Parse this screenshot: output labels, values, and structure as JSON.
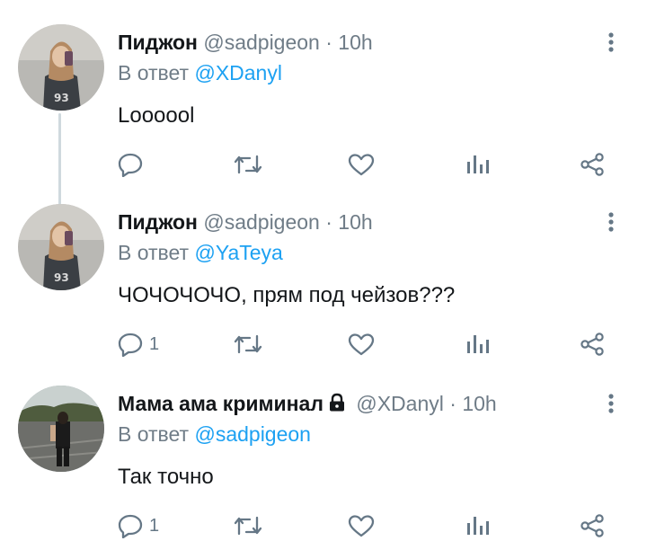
{
  "tweets": [
    {
      "name": "Пиджон",
      "handle": "@sadpigeon",
      "dot": "·",
      "time": "10h",
      "reply_prefix": "В ответ",
      "reply_to": "@YaTeya",
      "text": "ЧОЧОЧОЧО, прям под чейзов???",
      "reply_count": "1",
      "locked": false
    },
    {
      "name": "Мама ама криминал",
      "handle": "@XDanyl",
      "dot": "·",
      "time": "10h",
      "reply_prefix": "В ответ",
      "reply_to": "@sadpigeon",
      "text": "Так точно",
      "reply_count": "1",
      "locked": true
    },
    {
      "name": "Пиджон",
      "handle": "@sadpigeon",
      "dot": "·",
      "time": "10h",
      "reply_prefix": "В ответ",
      "reply_to": "@XDanyl",
      "text": "Loooool",
      "reply_count": "",
      "locked": false
    }
  ],
  "icons": {
    "reply": "reply-icon",
    "retweet": "retweet-icon",
    "like": "heart-icon",
    "stats": "stats-icon",
    "share": "share-icon",
    "more": "more-vertical-icon",
    "lock": "lock-icon"
  },
  "colors": {
    "link": "#1da1f2",
    "muted": "#6f7c87",
    "text": "#14171a",
    "thread_line": "#cfd9de"
  }
}
